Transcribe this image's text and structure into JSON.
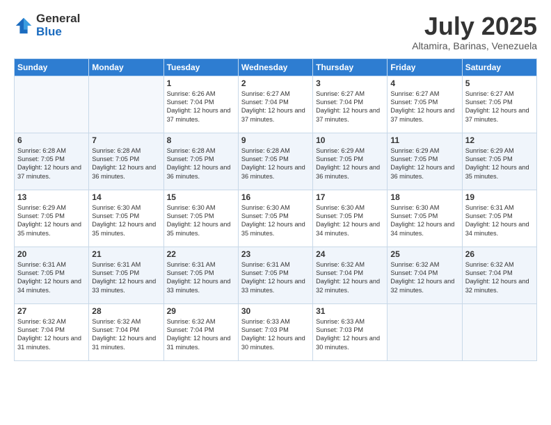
{
  "header": {
    "logo_general": "General",
    "logo_blue": "Blue",
    "month_title": "July 2025",
    "location": "Altamira, Barinas, Venezuela"
  },
  "calendar": {
    "days_of_week": [
      "Sunday",
      "Monday",
      "Tuesday",
      "Wednesday",
      "Thursday",
      "Friday",
      "Saturday"
    ],
    "weeks": [
      [
        {
          "day": "",
          "content": ""
        },
        {
          "day": "",
          "content": ""
        },
        {
          "day": "1",
          "content": "Sunrise: 6:26 AM\nSunset: 7:04 PM\nDaylight: 12 hours and 37 minutes."
        },
        {
          "day": "2",
          "content": "Sunrise: 6:27 AM\nSunset: 7:04 PM\nDaylight: 12 hours and 37 minutes."
        },
        {
          "day": "3",
          "content": "Sunrise: 6:27 AM\nSunset: 7:04 PM\nDaylight: 12 hours and 37 minutes."
        },
        {
          "day": "4",
          "content": "Sunrise: 6:27 AM\nSunset: 7:05 PM\nDaylight: 12 hours and 37 minutes."
        },
        {
          "day": "5",
          "content": "Sunrise: 6:27 AM\nSunset: 7:05 PM\nDaylight: 12 hours and 37 minutes."
        }
      ],
      [
        {
          "day": "6",
          "content": "Sunrise: 6:28 AM\nSunset: 7:05 PM\nDaylight: 12 hours and 37 minutes."
        },
        {
          "day": "7",
          "content": "Sunrise: 6:28 AM\nSunset: 7:05 PM\nDaylight: 12 hours and 36 minutes."
        },
        {
          "day": "8",
          "content": "Sunrise: 6:28 AM\nSunset: 7:05 PM\nDaylight: 12 hours and 36 minutes."
        },
        {
          "day": "9",
          "content": "Sunrise: 6:28 AM\nSunset: 7:05 PM\nDaylight: 12 hours and 36 minutes."
        },
        {
          "day": "10",
          "content": "Sunrise: 6:29 AM\nSunset: 7:05 PM\nDaylight: 12 hours and 36 minutes."
        },
        {
          "day": "11",
          "content": "Sunrise: 6:29 AM\nSunset: 7:05 PM\nDaylight: 12 hours and 36 minutes."
        },
        {
          "day": "12",
          "content": "Sunrise: 6:29 AM\nSunset: 7:05 PM\nDaylight: 12 hours and 35 minutes."
        }
      ],
      [
        {
          "day": "13",
          "content": "Sunrise: 6:29 AM\nSunset: 7:05 PM\nDaylight: 12 hours and 35 minutes."
        },
        {
          "day": "14",
          "content": "Sunrise: 6:30 AM\nSunset: 7:05 PM\nDaylight: 12 hours and 35 minutes."
        },
        {
          "day": "15",
          "content": "Sunrise: 6:30 AM\nSunset: 7:05 PM\nDaylight: 12 hours and 35 minutes."
        },
        {
          "day": "16",
          "content": "Sunrise: 6:30 AM\nSunset: 7:05 PM\nDaylight: 12 hours and 35 minutes."
        },
        {
          "day": "17",
          "content": "Sunrise: 6:30 AM\nSunset: 7:05 PM\nDaylight: 12 hours and 34 minutes."
        },
        {
          "day": "18",
          "content": "Sunrise: 6:30 AM\nSunset: 7:05 PM\nDaylight: 12 hours and 34 minutes."
        },
        {
          "day": "19",
          "content": "Sunrise: 6:31 AM\nSunset: 7:05 PM\nDaylight: 12 hours and 34 minutes."
        }
      ],
      [
        {
          "day": "20",
          "content": "Sunrise: 6:31 AM\nSunset: 7:05 PM\nDaylight: 12 hours and 34 minutes."
        },
        {
          "day": "21",
          "content": "Sunrise: 6:31 AM\nSunset: 7:05 PM\nDaylight: 12 hours and 33 minutes."
        },
        {
          "day": "22",
          "content": "Sunrise: 6:31 AM\nSunset: 7:05 PM\nDaylight: 12 hours and 33 minutes."
        },
        {
          "day": "23",
          "content": "Sunrise: 6:31 AM\nSunset: 7:05 PM\nDaylight: 12 hours and 33 minutes."
        },
        {
          "day": "24",
          "content": "Sunrise: 6:32 AM\nSunset: 7:04 PM\nDaylight: 12 hours and 32 minutes."
        },
        {
          "day": "25",
          "content": "Sunrise: 6:32 AM\nSunset: 7:04 PM\nDaylight: 12 hours and 32 minutes."
        },
        {
          "day": "26",
          "content": "Sunrise: 6:32 AM\nSunset: 7:04 PM\nDaylight: 12 hours and 32 minutes."
        }
      ],
      [
        {
          "day": "27",
          "content": "Sunrise: 6:32 AM\nSunset: 7:04 PM\nDaylight: 12 hours and 31 minutes."
        },
        {
          "day": "28",
          "content": "Sunrise: 6:32 AM\nSunset: 7:04 PM\nDaylight: 12 hours and 31 minutes."
        },
        {
          "day": "29",
          "content": "Sunrise: 6:32 AM\nSunset: 7:04 PM\nDaylight: 12 hours and 31 minutes."
        },
        {
          "day": "30",
          "content": "Sunrise: 6:33 AM\nSunset: 7:03 PM\nDaylight: 12 hours and 30 minutes."
        },
        {
          "day": "31",
          "content": "Sunrise: 6:33 AM\nSunset: 7:03 PM\nDaylight: 12 hours and 30 minutes."
        },
        {
          "day": "",
          "content": ""
        },
        {
          "day": "",
          "content": ""
        }
      ]
    ]
  }
}
